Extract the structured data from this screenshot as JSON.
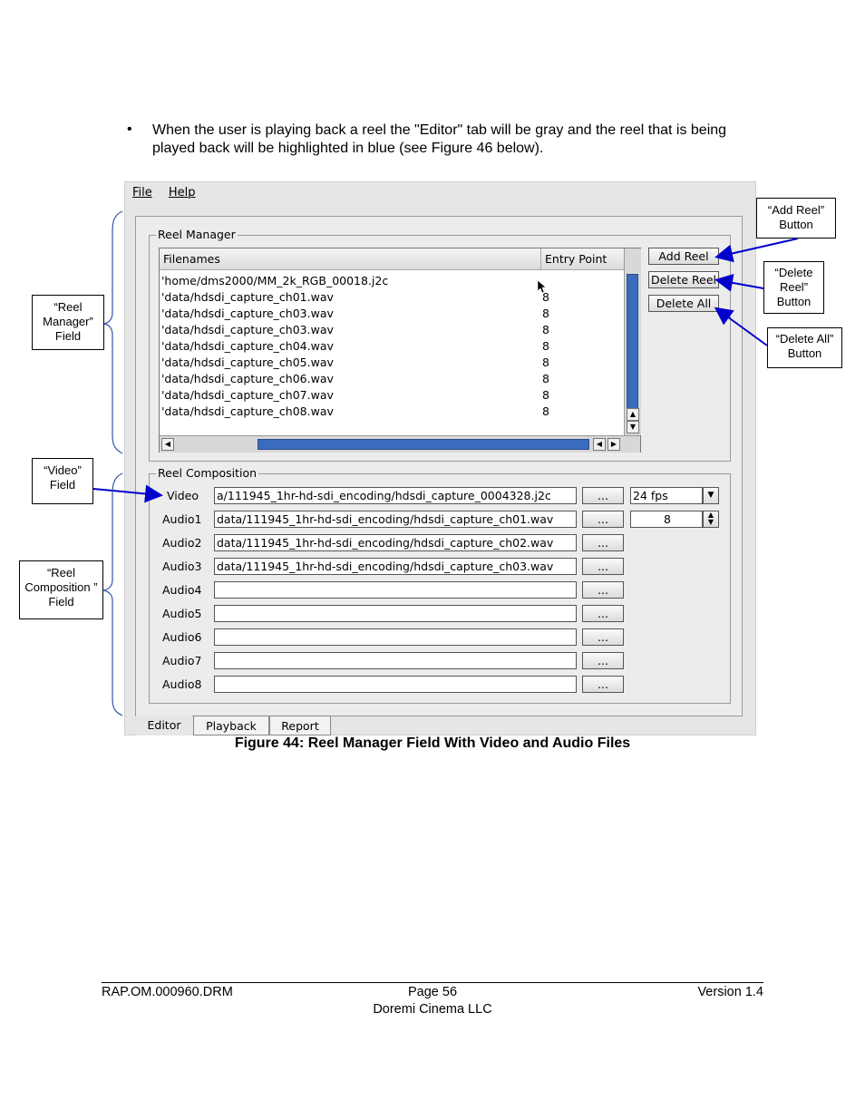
{
  "bullet": {
    "symbol": "•",
    "text": "When the user is playing back a reel the \"Editor\" tab will be gray and the reel that is being played back will be highlighted in blue (see Figure 46 below)."
  },
  "menu": {
    "file": "File",
    "help": "Help"
  },
  "reel_manager": {
    "title": "Reel Manager",
    "columns": [
      "Filenames",
      "Entry Point"
    ],
    "rows": [
      {
        "file": "'home/dms2000/MM_2k_RGB_00018.j2c",
        "entry": ""
      },
      {
        "file": "'data/hdsdi_capture_ch01.wav",
        "entry": "8"
      },
      {
        "file": "'data/hdsdi_capture_ch03.wav",
        "entry": "8"
      },
      {
        "file": "'data/hdsdi_capture_ch03.wav",
        "entry": "8"
      },
      {
        "file": "'data/hdsdi_capture_ch04.wav",
        "entry": "8"
      },
      {
        "file": "'data/hdsdi_capture_ch05.wav",
        "entry": "8"
      },
      {
        "file": "'data/hdsdi_capture_ch06.wav",
        "entry": "8"
      },
      {
        "file": "'data/hdsdi_capture_ch07.wav",
        "entry": "8"
      },
      {
        "file": "'data/hdsdi_capture_ch08.wav",
        "entry": "8"
      }
    ],
    "buttons": {
      "add": "Add Reel",
      "delete": "Delete Reel",
      "delete_all": "Delete All"
    }
  },
  "reel_composition": {
    "title": "Reel Composition",
    "browse": "...",
    "fps": "24 fps",
    "entry": "8",
    "rows": [
      {
        "label": "Video",
        "value": "a/111945_1hr-hd-sdi_encoding/hdsdi_capture_0004328.j2c"
      },
      {
        "label": "Audio1",
        "value": "data/111945_1hr-hd-sdi_encoding/hdsdi_capture_ch01.wav"
      },
      {
        "label": "Audio2",
        "value": "data/111945_1hr-hd-sdi_encoding/hdsdi_capture_ch02.wav"
      },
      {
        "label": "Audio3",
        "value": "data/111945_1hr-hd-sdi_encoding/hdsdi_capture_ch03.wav"
      },
      {
        "label": "Audio4",
        "value": ""
      },
      {
        "label": "Audio5",
        "value": ""
      },
      {
        "label": "Audio6",
        "value": ""
      },
      {
        "label": "Audio7",
        "value": ""
      },
      {
        "label": "Audio8",
        "value": ""
      }
    ]
  },
  "tabs": [
    "Editor",
    "Playback",
    "Report"
  ],
  "callouts": {
    "add_reel": "“Add Reel” Button",
    "delete_reel": "“Delete Reel” Button",
    "delete_all": "“Delete All” Button",
    "reel_manager": "“Reel Manager” Field",
    "video": "“Video” Field",
    "reel_composition": "“Reel Composition ” Field"
  },
  "caption": "Figure 44: Reel Manager Field With Video and Audio Files",
  "footer": {
    "doc_id": "RAP.OM.000960.DRM",
    "page": "Page 56",
    "version": "Version 1.4",
    "company": "Doremi Cinema LLC"
  },
  "colors": {
    "selection_blue": "#3b6bbd",
    "arrow_blue": "#0000cc"
  }
}
